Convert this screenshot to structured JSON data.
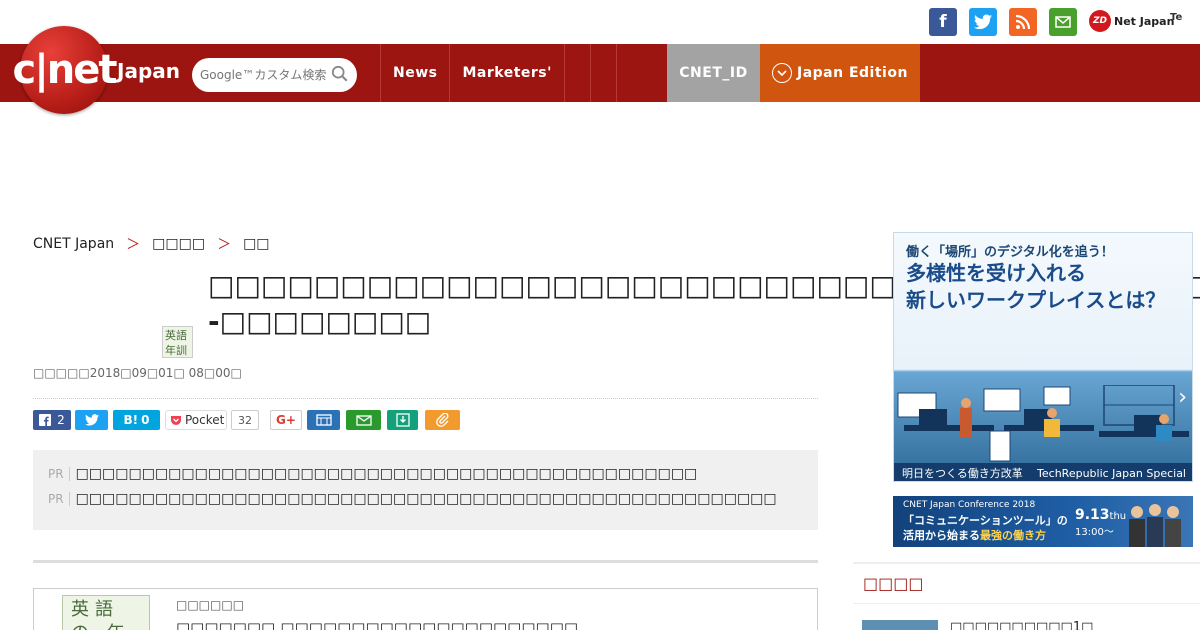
{
  "colors": {
    "brand_red": "#9c1510",
    "edition_orange": "#d0560f",
    "id_gray": "#a3a3a3",
    "facebook": "#3b5998",
    "twitter": "#1da1f2",
    "rss": "#f26522",
    "mail_green": "#4aa02c",
    "hatena": "#00a4de",
    "pocket": "#ef4056",
    "print_blue": "#2b71b6",
    "evernote_green": "#2b9a2e",
    "clip_orange": "#f29a2e"
  },
  "top_icons": [
    "facebook-icon",
    "twitter-icon",
    "rss-icon",
    "mail-icon"
  ],
  "partners": {
    "zdnet": "Net Japan",
    "zd_mark": "ZD",
    "techrepublic": "Te"
  },
  "logo": {
    "mark": "c|net",
    "sub": "Japan"
  },
  "search": {
    "placeholder": "Google™カスタム検索",
    "icon": "search-icon"
  },
  "nav": {
    "items": [
      "News",
      "Marketers'"
    ],
    "id_label": "CNET_ID",
    "edition_label": "Japan Edition",
    "edition_icon": "chevron-down-icon"
  },
  "breadcrumb": [
    "CNET Japan",
    "＞",
    "□□□□",
    "＞",
    "□□"
  ],
  "article": {
    "headline": "□□□□□□□□□□□□□□□□□□□□□□□□□□□□□□□□□□□□□□--□□□□□□□□",
    "thumb_text": "英語 年訓",
    "pubdate": "□□□□□2018□09□01□ 08□00□"
  },
  "share": {
    "facebook_count": "2",
    "hatena_label": "B!",
    "hatena_count": "0",
    "pocket_label": "Pocket",
    "pocket_count": "32",
    "gplus_label": "G+"
  },
  "pr": {
    "tag": "PR",
    "rows": [
      "□□□□□□□□□□□□□□□□□□□□□□□□□□□□□□□□□□□□□□□□□□□□□□□",
      "□□□□□□□□□□□□□□□□□□□□□□□□□□□□□□□□□□□□□□□□□□□□□□□□□□□□□"
    ]
  },
  "book": {
    "thumb_text": "英語の 年訓",
    "tag": "□□□□□□",
    "title": "□□□□□□□ □□□□□□□□□□□□□□□□□□□□□"
  },
  "ads": {
    "workplace": {
      "top": "働く「場所」のデジタル化を追う！",
      "main_line1": "多様性を受け入れる",
      "main_line2": "新しいワークプレイスとは？",
      "bottom_left": "明日をつくる働き方改革",
      "bottom_right": "TechRepublic Japan Special"
    },
    "conference": {
      "small": "CNET Japan Conference 2018",
      "line1": "「コミュニケーションツール」の",
      "line2_prefix": "活用から始まる",
      "line2_highlight": "最強の働き方",
      "date": "9.13",
      "day": "thu",
      "time": "13:00〜"
    }
  },
  "sidebar": {
    "section_title": "□□□□",
    "item_text": "□□□□□□□□□□1□"
  }
}
